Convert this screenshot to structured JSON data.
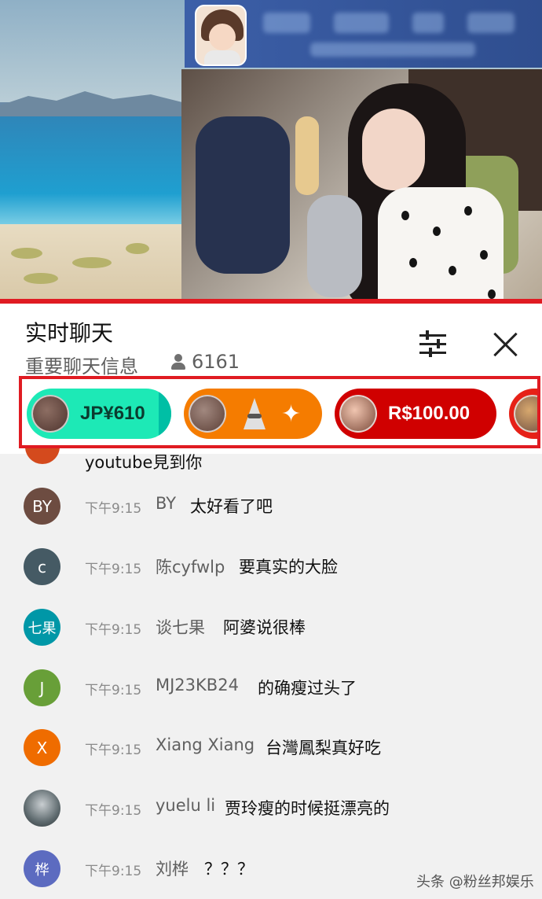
{
  "chat": {
    "title": "实时聊天",
    "subtitle": "重要聊天信息",
    "viewer_count": "6161",
    "icons": {
      "filter": "sliders-icon",
      "close": "close-icon",
      "viewers": "person-icon"
    }
  },
  "ticker": [
    {
      "amount": "JP¥610",
      "color": "#1de9b6"
    },
    {
      "amount": "",
      "sticker": true,
      "color": "#f57c00"
    },
    {
      "amount": "R$100.00",
      "color": "#d00000"
    },
    {
      "amount": "",
      "color": "#e62117"
    }
  ],
  "partial_message": "youtube見到你",
  "messages": [
    {
      "avatar": "BY",
      "avatar_color": "#6d4c41",
      "time": "下午9:15",
      "author": "BY",
      "text": "太好看了吧"
    },
    {
      "avatar": "c",
      "avatar_color": "#455a64",
      "time": "下午9:15",
      "author": "陈cyfwlp",
      "text": "要真实的大脸"
    },
    {
      "avatar": "七果",
      "avatar_color": "#0097a7",
      "time": "下午9:15",
      "author": "谈七果",
      "text": "阿婆说很棒"
    },
    {
      "avatar": "J",
      "avatar_color": "#689f38",
      "time": "下午9:15",
      "author": "MJ23KB24",
      "text": "的确瘦过头了"
    },
    {
      "avatar": "X",
      "avatar_color": "#ef6c00",
      "time": "下午9:15",
      "author": "Xiang Xiang",
      "text": "台灣鳳梨真好吃"
    },
    {
      "avatar": "",
      "avatar_color": "#5f6b6f",
      "time": "下午9:15",
      "author": "yuelu li",
      "text": "贾玲瘦的时候挺漂亮的"
    },
    {
      "avatar": "桦",
      "avatar_color": "#5c6bc0",
      "time": "下午9:15",
      "author": "刘桦",
      "text": "？？？"
    }
  ],
  "watermark": "头条 @粉丝邦娱乐"
}
